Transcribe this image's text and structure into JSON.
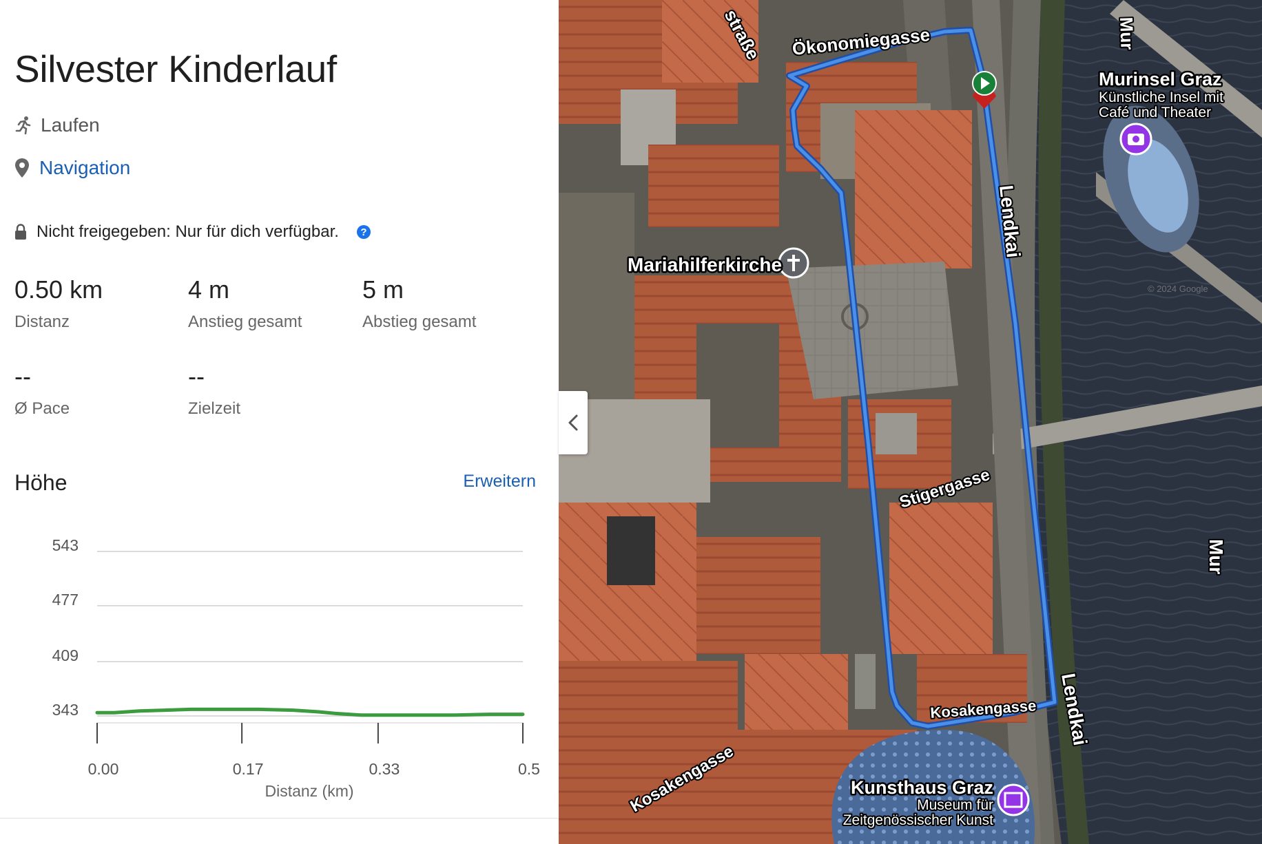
{
  "route": {
    "title": "Silvester Kinderlauf",
    "activity": "Laufen",
    "navigation_label": "Navigation",
    "privacy_text": "Nicht freigegeben: Nur für dich verfügbar.",
    "help_glyph": "?"
  },
  "stats": [
    {
      "value": "0.50 km",
      "label": "Distanz"
    },
    {
      "value": "4 m",
      "label": "Anstieg gesamt"
    },
    {
      "value": "5 m",
      "label": "Abstieg gesamt"
    },
    {
      "value": "--",
      "label": "Ø Pace"
    },
    {
      "value": "--",
      "label": "Zielzeit"
    }
  ],
  "elevation": {
    "title": "Höhe",
    "expand_label": "Erweitern"
  },
  "chart_data": {
    "type": "line",
    "xlabel": "Distanz (km)",
    "ylabel": "",
    "ylim": [
      343,
      543
    ],
    "xlim": [
      0,
      0.5
    ],
    "y_ticks": [
      "543",
      "477",
      "409",
      "343"
    ],
    "y_tick_values": [
      543,
      477,
      409,
      343
    ],
    "x_ticks": [
      "0.00",
      "0.17",
      "0.33",
      "0.5"
    ],
    "x_tick_values": [
      0,
      0.17,
      0.33,
      0.5
    ],
    "grid": true,
    "series": [
      {
        "name": "",
        "color": "#3c9a3f",
        "x": [
          0,
          0.02,
          0.05,
          0.08,
          0.11,
          0.15,
          0.19,
          0.23,
          0.26,
          0.28,
          0.31,
          0.34,
          0.38,
          0.42,
          0.46,
          0.5
        ],
        "y": [
          347,
          347,
          349,
          350,
          351,
          351,
          351,
          350,
          348,
          346,
          344,
          344,
          344,
          344,
          345,
          345
        ]
      }
    ]
  },
  "map": {
    "labels": {
      "oekonomiegasse": "Ökonomiegasse",
      "strasse": "straße",
      "mariahilferkirche": "Mariahilferkirche",
      "murinsel_title": "Murinsel Graz",
      "murinsel_sub1": "Künstliche Insel mit",
      "murinsel_sub2": "Café und Theater",
      "mur_top": "Mur",
      "mur_right": "Mur",
      "lendkai_top": "Lendkai",
      "lendkai_bottom": "Lendkai",
      "stigergasse": "Stigergasse",
      "kosakengasse_top": "Kosakengasse",
      "kosakengasse_bottom": "Kosakengasse",
      "kunsthaus_title": "Kunsthaus Graz",
      "kunsthaus_sub1": "Museum für",
      "kunsthaus_sub2": "Zeitgenössischer Kunst",
      "copyright": "© 2024 Google"
    }
  }
}
